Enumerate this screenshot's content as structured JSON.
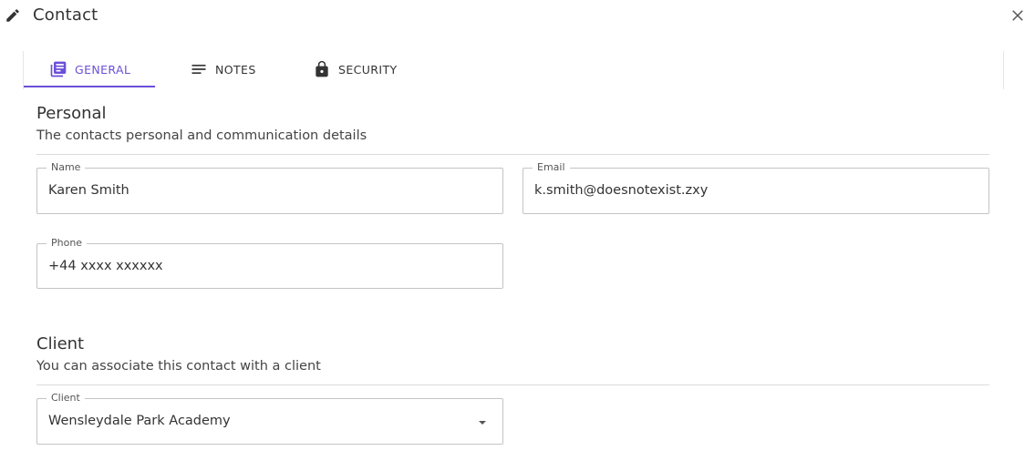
{
  "dialog": {
    "title": "Contact",
    "icons": {
      "edit": "pencil-icon",
      "close": "close-icon"
    }
  },
  "tabs": [
    {
      "label": "GENERAL",
      "icon": "library-books-icon",
      "active": true
    },
    {
      "label": "NOTES",
      "icon": "notes-lines-icon",
      "active": false
    },
    {
      "label": "SECURITY",
      "icon": "lock-icon",
      "active": false
    }
  ],
  "personal": {
    "title": "Personal",
    "subtitle": "The contacts personal and communication details",
    "name": {
      "label": "Name",
      "value": "Karen Smith"
    },
    "email": {
      "label": "Email",
      "value": "k.smith@doesnotexist.zxy"
    },
    "phone": {
      "label": "Phone",
      "value": "+44 xxxx xxxxxx"
    }
  },
  "client": {
    "title": "Client",
    "subtitle": "You can associate this contact with a client",
    "select": {
      "label": "Client",
      "value": "Wensleydale Park Academy",
      "icon": "caret-down-icon"
    }
  },
  "colors": {
    "accent": "#6b4fd8",
    "text": "#333333",
    "border": "#c4c4c4",
    "divider": "#dcdcdc"
  }
}
